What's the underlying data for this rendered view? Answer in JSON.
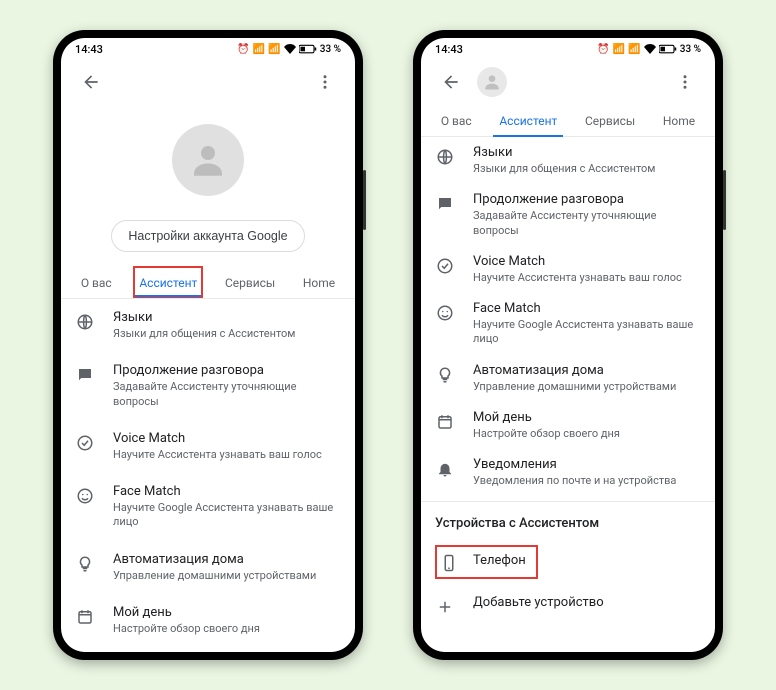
{
  "status": {
    "time": "14:43",
    "battery": "33 %"
  },
  "p1": {
    "account_btn": "Настройки аккаунта Google",
    "tabs": [
      "О вас",
      "Ассистент",
      "Сервисы",
      "Home"
    ],
    "items": [
      {
        "title": "Языки",
        "sub": "Языки для общения с Ассистентом"
      },
      {
        "title": "Продолжение разговора",
        "sub": "Задавайте Ассистенту уточняющие вопросы"
      },
      {
        "title": "Voice Match",
        "sub": "Научите Ассистента узнавать ваш голос"
      },
      {
        "title": "Face Match",
        "sub": "Научите Google Ассистента узнавать ваше лицо"
      },
      {
        "title": "Автоматизация дома",
        "sub": "Управление домашними устройствами"
      },
      {
        "title": "Мой день",
        "sub": "Настройте обзор своего дня"
      }
    ]
  },
  "p2": {
    "tabs": [
      "О вас",
      "Ассистент",
      "Сервисы",
      "Home"
    ],
    "items": [
      {
        "title": "Языки",
        "sub": "Языки для общения с Ассистентом"
      },
      {
        "title": "Продолжение разговора",
        "sub": "Задавайте Ассистенту уточняющие вопросы"
      },
      {
        "title": "Voice Match",
        "sub": "Научите Ассистента узнавать ваш голос"
      },
      {
        "title": "Face Match",
        "sub": "Научите Google Ассистента узнавать ваше лицо"
      },
      {
        "title": "Автоматизация дома",
        "sub": "Управление домашними устройствами"
      },
      {
        "title": "Мой день",
        "sub": "Настройте обзор своего дня"
      },
      {
        "title": "Уведомления",
        "sub": "Уведомления по почте и на устройства"
      }
    ],
    "section": "Устройства с Ассистентом",
    "phone_item": "Телефон",
    "add_device": "Добавьте устройство"
  }
}
